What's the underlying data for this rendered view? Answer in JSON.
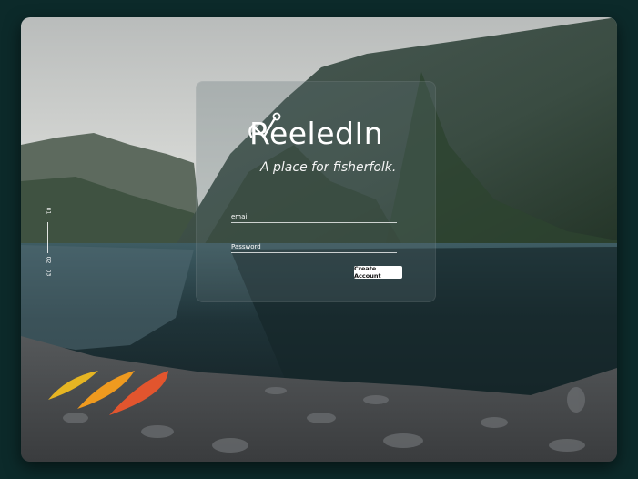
{
  "brand": {
    "name": "ReeledIn",
    "tagline": "A place for fisherfolk."
  },
  "form": {
    "email_label": "email",
    "password_label": "Password",
    "submit_label": "Create Account"
  },
  "pager": {
    "current": "01",
    "second": "02",
    "third": "03"
  },
  "colors": {
    "page_bg": "#0c2a2a",
    "button_bg": "#ffffff",
    "text": "#ffffff"
  }
}
